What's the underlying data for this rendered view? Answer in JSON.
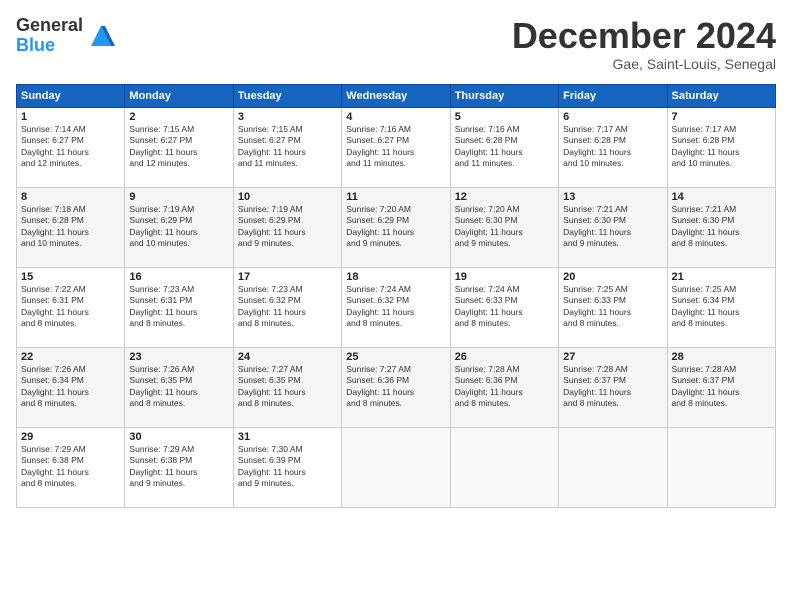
{
  "logo": {
    "general": "General",
    "blue": "Blue"
  },
  "title": "December 2024",
  "location": "Gae, Saint-Louis, Senegal",
  "days_header": [
    "Sunday",
    "Monday",
    "Tuesday",
    "Wednesday",
    "Thursday",
    "Friday",
    "Saturday"
  ],
  "weeks": [
    [
      {
        "day": "1",
        "info": "Sunrise: 7:14 AM\nSunset: 6:27 PM\nDaylight: 11 hours\nand 12 minutes."
      },
      {
        "day": "2",
        "info": "Sunrise: 7:15 AM\nSunset: 6:27 PM\nDaylight: 11 hours\nand 12 minutes."
      },
      {
        "day": "3",
        "info": "Sunrise: 7:15 AM\nSunset: 6:27 PM\nDaylight: 11 hours\nand 11 minutes."
      },
      {
        "day": "4",
        "info": "Sunrise: 7:16 AM\nSunset: 6:27 PM\nDaylight: 11 hours\nand 11 minutes."
      },
      {
        "day": "5",
        "info": "Sunrise: 7:16 AM\nSunset: 6:28 PM\nDaylight: 11 hours\nand 11 minutes."
      },
      {
        "day": "6",
        "info": "Sunrise: 7:17 AM\nSunset: 6:28 PM\nDaylight: 11 hours\nand 10 minutes."
      },
      {
        "day": "7",
        "info": "Sunrise: 7:17 AM\nSunset: 6:28 PM\nDaylight: 11 hours\nand 10 minutes."
      }
    ],
    [
      {
        "day": "8",
        "info": "Sunrise: 7:18 AM\nSunset: 6:28 PM\nDaylight: 11 hours\nand 10 minutes."
      },
      {
        "day": "9",
        "info": "Sunrise: 7:19 AM\nSunset: 6:29 PM\nDaylight: 11 hours\nand 10 minutes."
      },
      {
        "day": "10",
        "info": "Sunrise: 7:19 AM\nSunset: 6:29 PM\nDaylight: 11 hours\nand 9 minutes."
      },
      {
        "day": "11",
        "info": "Sunrise: 7:20 AM\nSunset: 6:29 PM\nDaylight: 11 hours\nand 9 minutes."
      },
      {
        "day": "12",
        "info": "Sunrise: 7:20 AM\nSunset: 6:30 PM\nDaylight: 11 hours\nand 9 minutes."
      },
      {
        "day": "13",
        "info": "Sunrise: 7:21 AM\nSunset: 6:30 PM\nDaylight: 11 hours\nand 9 minutes."
      },
      {
        "day": "14",
        "info": "Sunrise: 7:21 AM\nSunset: 6:30 PM\nDaylight: 11 hours\nand 8 minutes."
      }
    ],
    [
      {
        "day": "15",
        "info": "Sunrise: 7:22 AM\nSunset: 6:31 PM\nDaylight: 11 hours\nand 8 minutes."
      },
      {
        "day": "16",
        "info": "Sunrise: 7:23 AM\nSunset: 6:31 PM\nDaylight: 11 hours\nand 8 minutes."
      },
      {
        "day": "17",
        "info": "Sunrise: 7:23 AM\nSunset: 6:32 PM\nDaylight: 11 hours\nand 8 minutes."
      },
      {
        "day": "18",
        "info": "Sunrise: 7:24 AM\nSunset: 6:32 PM\nDaylight: 11 hours\nand 8 minutes."
      },
      {
        "day": "19",
        "info": "Sunrise: 7:24 AM\nSunset: 6:33 PM\nDaylight: 11 hours\nand 8 minutes."
      },
      {
        "day": "20",
        "info": "Sunrise: 7:25 AM\nSunset: 6:33 PM\nDaylight: 11 hours\nand 8 minutes."
      },
      {
        "day": "21",
        "info": "Sunrise: 7:25 AM\nSunset: 6:34 PM\nDaylight: 11 hours\nand 8 minutes."
      }
    ],
    [
      {
        "day": "22",
        "info": "Sunrise: 7:26 AM\nSunset: 6:34 PM\nDaylight: 11 hours\nand 8 minutes."
      },
      {
        "day": "23",
        "info": "Sunrise: 7:26 AM\nSunset: 6:35 PM\nDaylight: 11 hours\nand 8 minutes."
      },
      {
        "day": "24",
        "info": "Sunrise: 7:27 AM\nSunset: 6:35 PM\nDaylight: 11 hours\nand 8 minutes."
      },
      {
        "day": "25",
        "info": "Sunrise: 7:27 AM\nSunset: 6:36 PM\nDaylight: 11 hours\nand 8 minutes."
      },
      {
        "day": "26",
        "info": "Sunrise: 7:28 AM\nSunset: 6:36 PM\nDaylight: 11 hours\nand 8 minutes."
      },
      {
        "day": "27",
        "info": "Sunrise: 7:28 AM\nSunset: 6:37 PM\nDaylight: 11 hours\nand 8 minutes."
      },
      {
        "day": "28",
        "info": "Sunrise: 7:28 AM\nSunset: 6:37 PM\nDaylight: 11 hours\nand 8 minutes."
      }
    ],
    [
      {
        "day": "29",
        "info": "Sunrise: 7:29 AM\nSunset: 6:38 PM\nDaylight: 11 hours\nand 8 minutes."
      },
      {
        "day": "30",
        "info": "Sunrise: 7:29 AM\nSunset: 6:38 PM\nDaylight: 11 hours\nand 9 minutes."
      },
      {
        "day": "31",
        "info": "Sunrise: 7:30 AM\nSunset: 6:39 PM\nDaylight: 11 hours\nand 9 minutes."
      },
      {
        "day": "",
        "info": ""
      },
      {
        "day": "",
        "info": ""
      },
      {
        "day": "",
        "info": ""
      },
      {
        "day": "",
        "info": ""
      }
    ]
  ]
}
